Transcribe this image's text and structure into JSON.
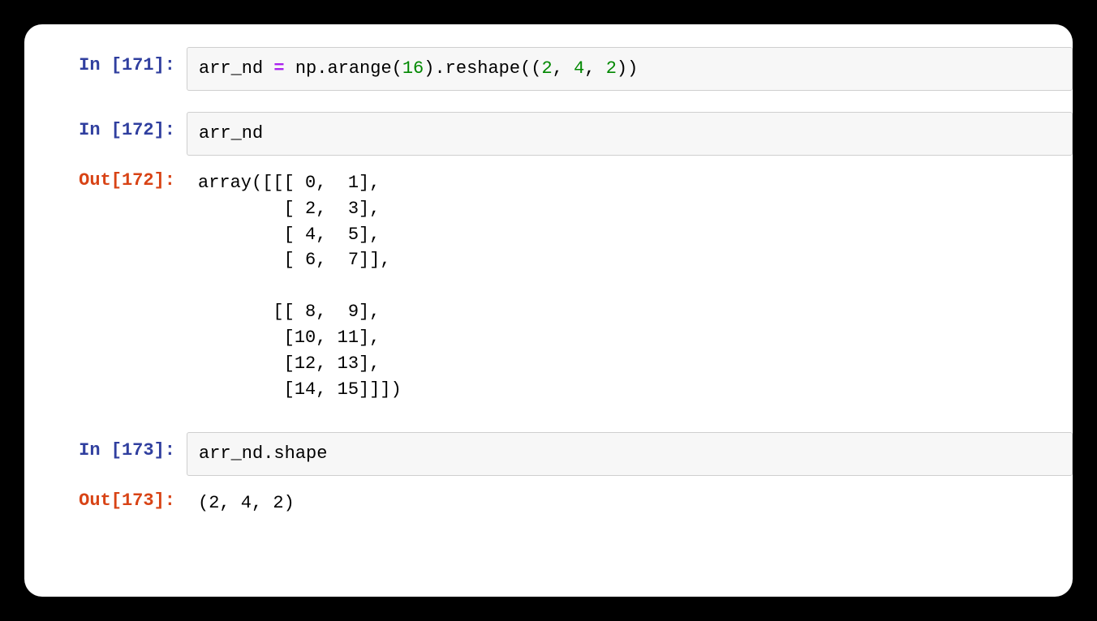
{
  "cells": [
    {
      "type": "in",
      "promptLabel": "In ",
      "execCount": "171",
      "tokens": [
        {
          "cls": "t-name",
          "text": "arr_nd "
        },
        {
          "cls": "t-op",
          "text": "="
        },
        {
          "cls": "t-name",
          "text": " np"
        },
        {
          "cls": "t-punc",
          "text": "."
        },
        {
          "cls": "t-name",
          "text": "arange"
        },
        {
          "cls": "t-punc",
          "text": "("
        },
        {
          "cls": "t-num",
          "text": "16"
        },
        {
          "cls": "t-punc",
          "text": ")"
        },
        {
          "cls": "t-punc",
          "text": "."
        },
        {
          "cls": "t-name",
          "text": "reshape"
        },
        {
          "cls": "t-punc",
          "text": "(("
        },
        {
          "cls": "t-num",
          "text": "2"
        },
        {
          "cls": "t-punc",
          "text": ", "
        },
        {
          "cls": "t-num",
          "text": "4"
        },
        {
          "cls": "t-punc",
          "text": ", "
        },
        {
          "cls": "t-num",
          "text": "2"
        },
        {
          "cls": "t-punc",
          "text": "))"
        }
      ]
    },
    {
      "type": "in",
      "promptLabel": "In ",
      "execCount": "172",
      "tokens": [
        {
          "cls": "t-name",
          "text": "arr_nd"
        }
      ]
    },
    {
      "type": "out",
      "promptLabel": "Out",
      "execCount": "172",
      "text": "array([[[ 0,  1],\n        [ 2,  3],\n        [ 4,  5],\n        [ 6,  7]],\n\n       [[ 8,  9],\n        [10, 11],\n        [12, 13],\n        [14, 15]]])"
    },
    {
      "type": "in",
      "promptLabel": "In ",
      "execCount": "173",
      "tokens": [
        {
          "cls": "t-name",
          "text": "arr_nd"
        },
        {
          "cls": "t-punc",
          "text": "."
        },
        {
          "cls": "t-name",
          "text": "shape"
        }
      ]
    },
    {
      "type": "out",
      "promptLabel": "Out",
      "execCount": "173",
      "text": "(2, 4, 2)"
    }
  ]
}
